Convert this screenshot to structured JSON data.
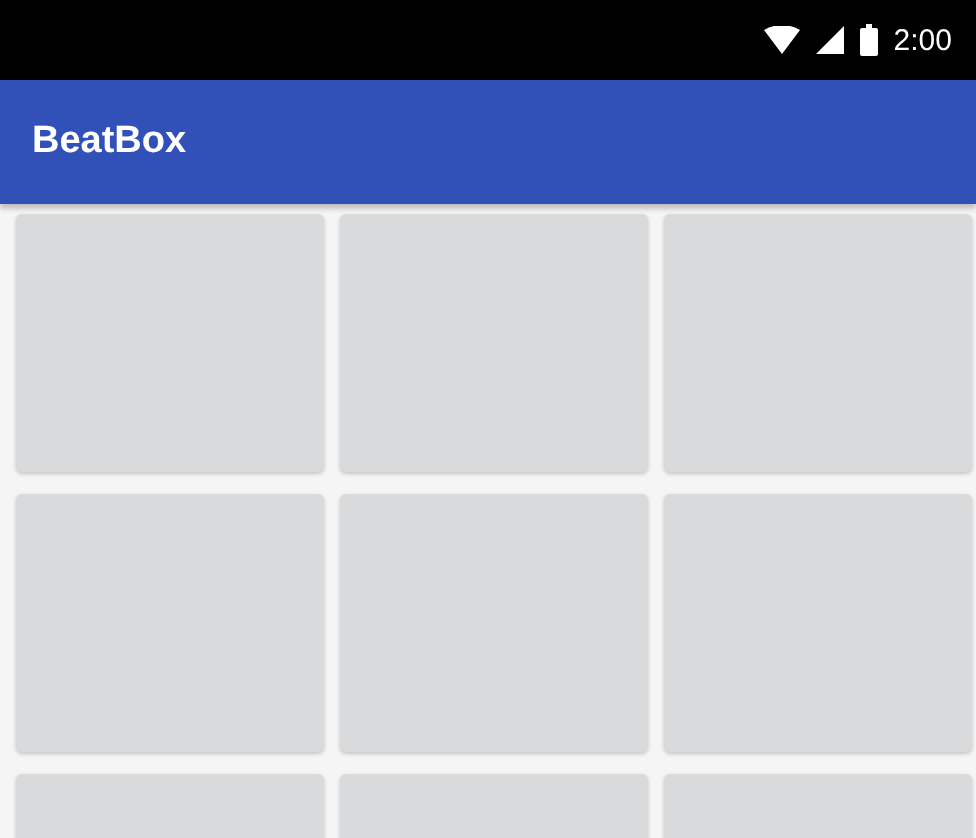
{
  "status_bar": {
    "time": "2:00"
  },
  "app_bar": {
    "title": "BeatBox"
  },
  "sound_buttons": [
    {
      "kind": "tile"
    },
    {
      "kind": "tile"
    },
    {
      "kind": "tile"
    },
    {
      "kind": "tile"
    },
    {
      "kind": "tile"
    },
    {
      "kind": "tile"
    },
    {
      "kind": "tile"
    },
    {
      "kind": "tile"
    },
    {
      "kind": "tile"
    }
  ]
}
